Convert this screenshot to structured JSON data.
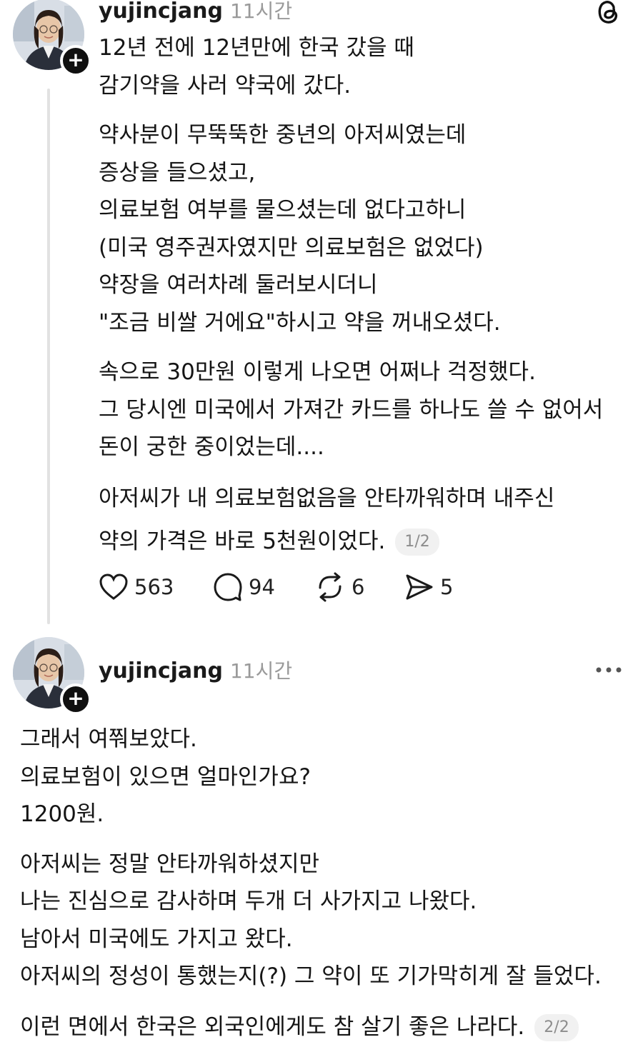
{
  "post1": {
    "username": "yujincjang",
    "time": "11시간",
    "paragraphs": [
      "12년 전에 12년만에 한국 갔을 때\n감기약을 사러 약국에 갔다.",
      "약사분이 무뚝뚝한 중년의 아저씨였는데\n증상을 들으셨고,\n의료보험 여부를 물으셨는데 없다고하니\n(미국 영주권자였지만 의료보험은 없었다)\n약장을 여러차례 둘러보시더니\n\"조금 비쌀 거에요\"하시고 약을 꺼내오셨다.",
      "속으로 30만원 이렇게 나오면 어쩌나 걱정했다.\n그 당시엔 미국에서 가져간 카드를 하나도 쓸 수 없어서\n돈이 궁한 중이었는데....",
      "아저씨가 내 의료보험없음을 안타까워하며 내주신"
    ],
    "last_line": "약의 가격은 바로 5천원이었다.",
    "page_badge": "1/2",
    "actions": {
      "likes": "563",
      "comments": "94",
      "reposts": "6",
      "shares": "5"
    }
  },
  "post2": {
    "username": "yujincjang",
    "time": "11시간",
    "paragraphs": [
      "그래서 여쭤보았다.\n의료보험이 있으면 얼마인가요?\n1200원.",
      "아저씨는 정말 안타까워하셨지만\n나는 진심으로 감사하며 두개 더 사가지고 나왔다.\n남아서 미국에도 가지고 왔다.\n아저씨의 정성이 통했는지(?) 그 약이 또 기가막히게 잘 들었다."
    ],
    "last_line": "이런 면에서 한국은 외국인에게도 참 살기 좋은 나라다.",
    "page_badge": "2/2"
  },
  "icons": {
    "app": "threads-logo-icon",
    "like": "heart-icon",
    "comment": "comment-bubble-icon",
    "repost": "repost-icon",
    "share": "send-icon",
    "more": "more-dots-icon",
    "follow": "plus-icon"
  }
}
